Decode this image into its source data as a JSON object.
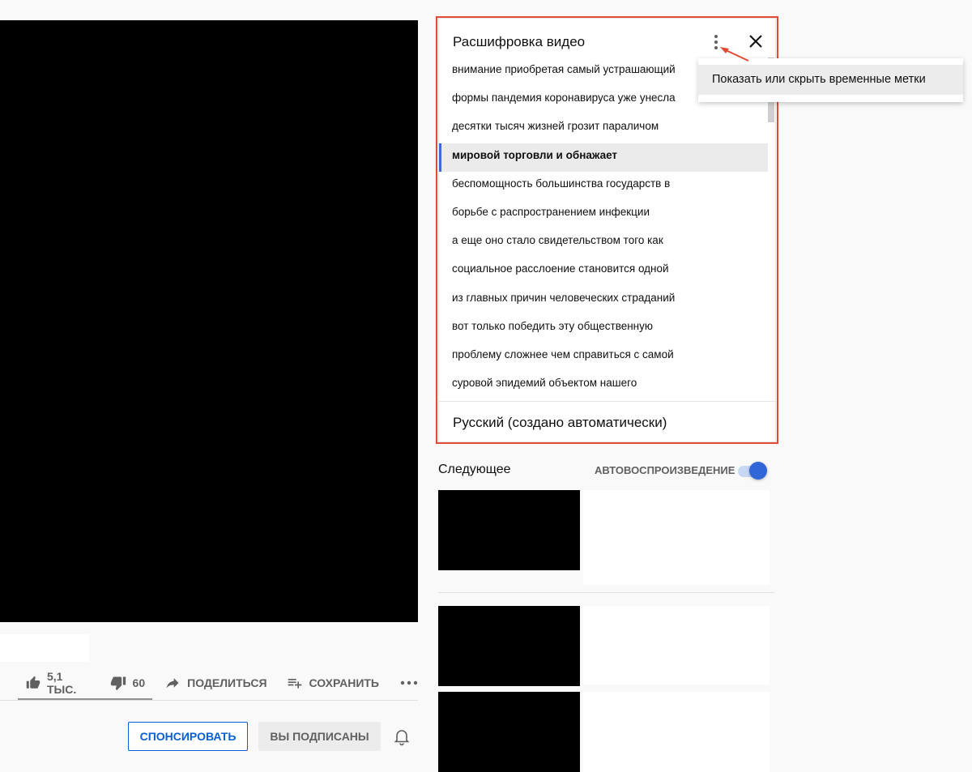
{
  "transcript": {
    "title": "Расшифровка видео",
    "lines": [
      "внимание приобретая самый устрашающий",
      "формы пандемия коронавируса уже унесла",
      "десятки тысяч жизней грозит параличом",
      "мировой торговли и обнажает",
      "беспомощность большинства государств в",
      "борьбе с распространением инфекции",
      "а еще оно стало свидетельством того как",
      "социальное расслоение становится одной",
      "из главных причин человеческих страданий",
      "вот только победить эту общественную",
      "проблему сложнее чем справиться с самой",
      "суровой эпидемий объектом нашего"
    ],
    "active_line_index": 3,
    "language": "Русский (создано автоматически)"
  },
  "menu": {
    "toggle_timestamps": "Показать или скрыть временные метки"
  },
  "actions": {
    "likes": "5,1 ТЫС.",
    "dislikes": "60",
    "share": "ПОДЕЛИТЬСЯ",
    "save": "СОХРАНИТЬ"
  },
  "channel": {
    "sponsor": "СПОНСИРОВАТЬ",
    "subscribed": "ВЫ ПОДПИСАНЫ"
  },
  "upnext": {
    "title": "Следующее",
    "autoplay_label": "АВТОВОСПРОИЗВЕДЕНИЕ",
    "autoplay_on": true
  },
  "colors": {
    "accent_blue": "#065fd4",
    "toggle_blue": "#3166d8",
    "annotation_red": "#e34a33",
    "active_line_marker": "#3f6bd6"
  }
}
